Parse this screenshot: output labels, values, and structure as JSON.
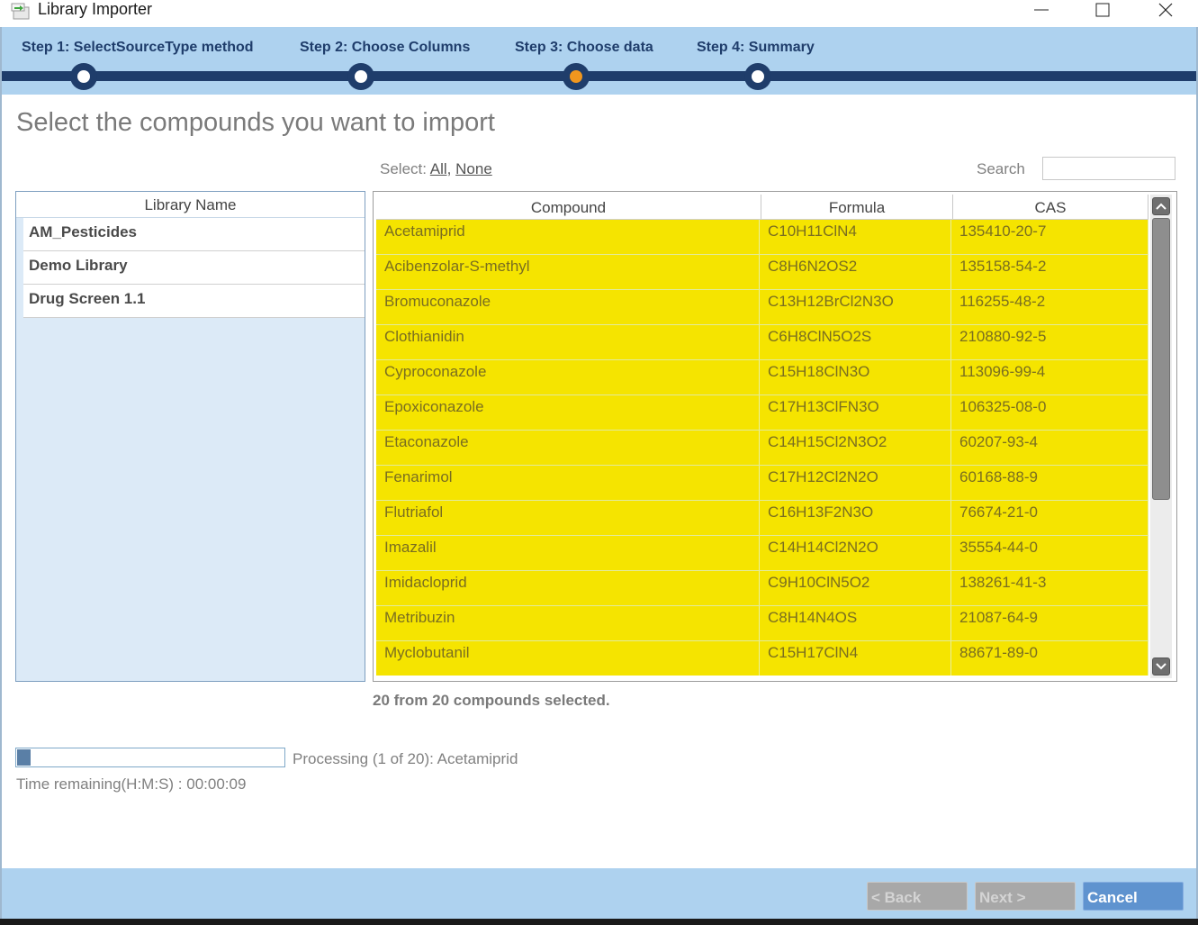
{
  "window": {
    "title": "Library Importer",
    "min_icon": "minimize-icon",
    "max_icon": "maximize-icon",
    "close_icon": "close-icon"
  },
  "steps": [
    {
      "label": "Step 1: SelectSourceType method",
      "state": "done"
    },
    {
      "label": "Step 2: Choose Columns",
      "state": "done"
    },
    {
      "label": "Step 3: Choose data",
      "state": "current"
    },
    {
      "label": "Step 4: Summary",
      "state": "pending"
    }
  ],
  "page": {
    "heading": "Select the compounds you want to import",
    "select_prefix": "Select:",
    "select_all": "All,",
    "select_none": "None",
    "search_label": "Search",
    "search_value": ""
  },
  "library": {
    "header": "Library Name",
    "items": [
      "AM_Pesticides",
      "Demo Library",
      "Drug Screen 1.1"
    ]
  },
  "grid": {
    "columns": [
      "Compound",
      "Formula",
      "CAS"
    ],
    "rows": [
      [
        "Acetamiprid",
        "C10H11ClN4",
        "135410-20-7"
      ],
      [
        "Acibenzolar-S-methyl",
        "C8H6N2OS2",
        "135158-54-2"
      ],
      [
        "Bromuconazole",
        "C13H12BrCl2N3O",
        "116255-48-2"
      ],
      [
        "Clothianidin",
        "C6H8ClN5O2S",
        "210880-92-5"
      ],
      [
        "Cyproconazole",
        "C15H18ClN3O",
        "113096-99-4"
      ],
      [
        "Epoxiconazole",
        "C17H13ClFN3O",
        "106325-08-0"
      ],
      [
        "Etaconazole",
        "C14H15Cl2N3O2",
        "60207-93-4"
      ],
      [
        "Fenarimol",
        "C17H12Cl2N2O",
        "60168-88-9"
      ],
      [
        "Flutriafol",
        "C16H13F2N3O",
        "76674-21-0"
      ],
      [
        "Imazalil",
        "C14H14Cl2N2O",
        "35554-44-0"
      ],
      [
        "Imidacloprid",
        "C9H10ClN5O2",
        "138261-41-3"
      ],
      [
        "Metribuzin",
        "C8H14N4OS",
        "21087-64-9"
      ],
      [
        "Myclobutanil",
        "C15H17ClN4",
        "88671-89-0"
      ]
    ],
    "selected_summary": "20 from 20 compounds selected."
  },
  "progress": {
    "fraction": 0.05,
    "processing_text": "Processing (1 of 20): Acetamiprid",
    "time_remaining": "Time remaining(H:M:S) : 00:00:09"
  },
  "buttons": {
    "back": "< Back",
    "next": "Next >",
    "cancel": "Cancel"
  },
  "colors": {
    "accent": "#1f3d6b",
    "step_bar": "#aed2ef",
    "current_step": "#f0961e",
    "row_selected": "#f5e400",
    "cancel_button": "#5f93cf"
  }
}
